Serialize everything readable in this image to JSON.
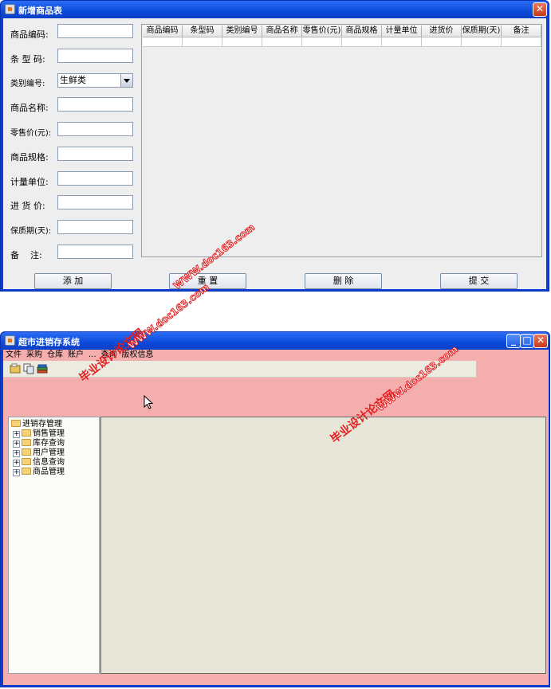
{
  "dialog": {
    "title": "新增商品表",
    "close": "✕",
    "fields": [
      {
        "label": "商品编码:",
        "value": ""
      },
      {
        "label": "条 型 码:",
        "value": ""
      },
      {
        "label": "类别编号:",
        "value": "生鲜类",
        "type": "combo"
      },
      {
        "label": "商品名称:",
        "value": ""
      },
      {
        "label": "零售价(元):",
        "value": ""
      },
      {
        "label": "商品规格:",
        "value": ""
      },
      {
        "label": "计量单位:",
        "value": ""
      },
      {
        "label": "进 货 价:",
        "value": ""
      },
      {
        "label": "保质期(天):",
        "value": ""
      },
      {
        "label": "备    注:",
        "value": ""
      }
    ],
    "table_headers": [
      "商品编码",
      "条型码",
      "类别编号",
      "商品名称",
      "零售价(元)",
      "商品规格",
      "计量单位",
      "进货价",
      "保质期(天)",
      "备注"
    ],
    "buttons": [
      "添 加",
      "重 置",
      "删 除",
      "提 交"
    ]
  },
  "main": {
    "title": "超市进销存系统",
    "window_controls": {
      "min": "_",
      "max": "□",
      "close": "✕"
    },
    "menu": [
      "文件",
      "采购",
      "仓库",
      "账户",
      "...",
      "查询",
      "版权信息"
    ],
    "toolbar_icons": [
      "open-icon",
      "copy-icon",
      "books-icon"
    ],
    "tree": {
      "root": "进销存管理",
      "children": [
        "销售管理",
        "库存查询",
        "用户管理",
        "信息查询",
        "商品管理"
      ]
    }
  },
  "watermarks": {
    "site_cn": "毕业设计论文网",
    "site_url": "WWW.doc163.com"
  },
  "colors": {
    "title_blue": "#0b4ad8",
    "main_background": "#f5aeae",
    "content_panel": "#e8e6d9",
    "watermark_red": "#e31d1d"
  }
}
